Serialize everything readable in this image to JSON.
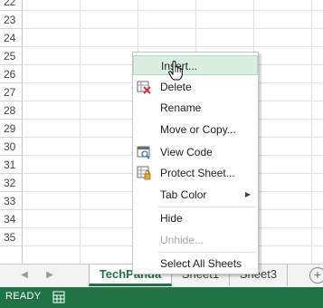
{
  "rows": [
    "22",
    "23",
    "24",
    "25",
    "26",
    "27",
    "28",
    "29",
    "30",
    "31",
    "32",
    "33",
    "34",
    "35"
  ],
  "tabs": {
    "sheets": [
      "TechPanda",
      "Sheet1",
      "Sheet3"
    ],
    "add_symbol": "+",
    "nav_prev": "◀",
    "nav_next": "▶"
  },
  "status": {
    "text": "READY"
  },
  "menu": {
    "insert": "Insert...",
    "delete": "Delete",
    "rename": "Rename",
    "move_copy": "Move or Copy...",
    "view_code": "View Code",
    "protect_sheet": "Protect Sheet...",
    "tab_color": "Tab Color",
    "hide": "Hide",
    "unhide": "Unhide...",
    "select_all": "Select All Sheets"
  },
  "colors": {
    "accent": "#217346",
    "hover": "#d9eedf"
  }
}
